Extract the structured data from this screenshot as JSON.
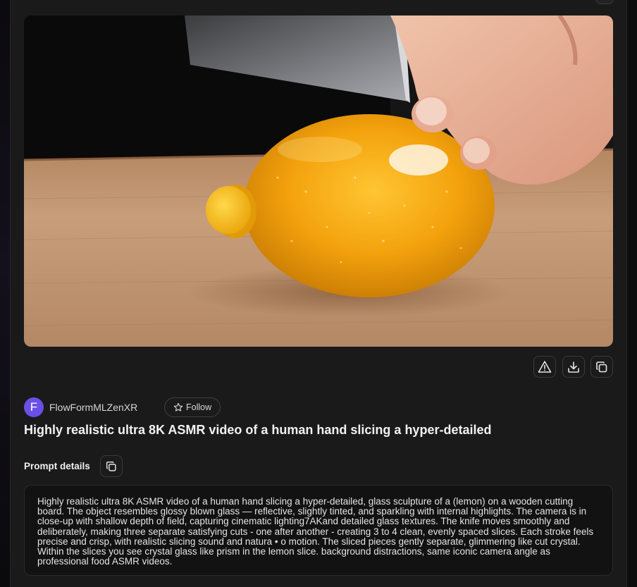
{
  "media": {
    "kind": "video-thumbnail",
    "description_icon": "lemon-glass-sculpture-image"
  },
  "actions": {
    "report_icon": "warning-triangle-icon",
    "download_icon": "download-icon",
    "copy_icon": "copy-icon"
  },
  "author": {
    "avatar_letter": "F",
    "avatar_color": "#6a50e6",
    "name": "FlowFormMLZenXR",
    "follow_label": "Follow",
    "follow_icon": "star-icon"
  },
  "video": {
    "title": "Highly realistic ultra 8K ASMR video of a human hand slicing a hyper-detailed"
  },
  "prompt": {
    "label": "Prompt details",
    "copy_icon": "copy-icon",
    "text": "Highly realistic ultra 8K ASMR video of a human hand slicing a hyper-detailed, glass sculpture of a (lemon) on a wooden cutting board. The object resembles glossy blown glass — reflective, slightly tinted, and sparkling with internal highlights. The camera is in close-up with shallow depth of field, capturing cinematic lighting7AKand detailed glass textures. The knife moves smoothly and deliberately, making three separate satisfying cuts - one after another - creating 3 to 4 clean, evenly spaced slices. Each stroke feels precise and crisp, with realistic slicing sound and natura • o motion. The sliced pieces gently separate, glimmering like cut crystal. Within the slices you see crystal glass like prism in the lemon slice. background distractions, same iconic camera angle as professional food ASMR videos."
  }
}
